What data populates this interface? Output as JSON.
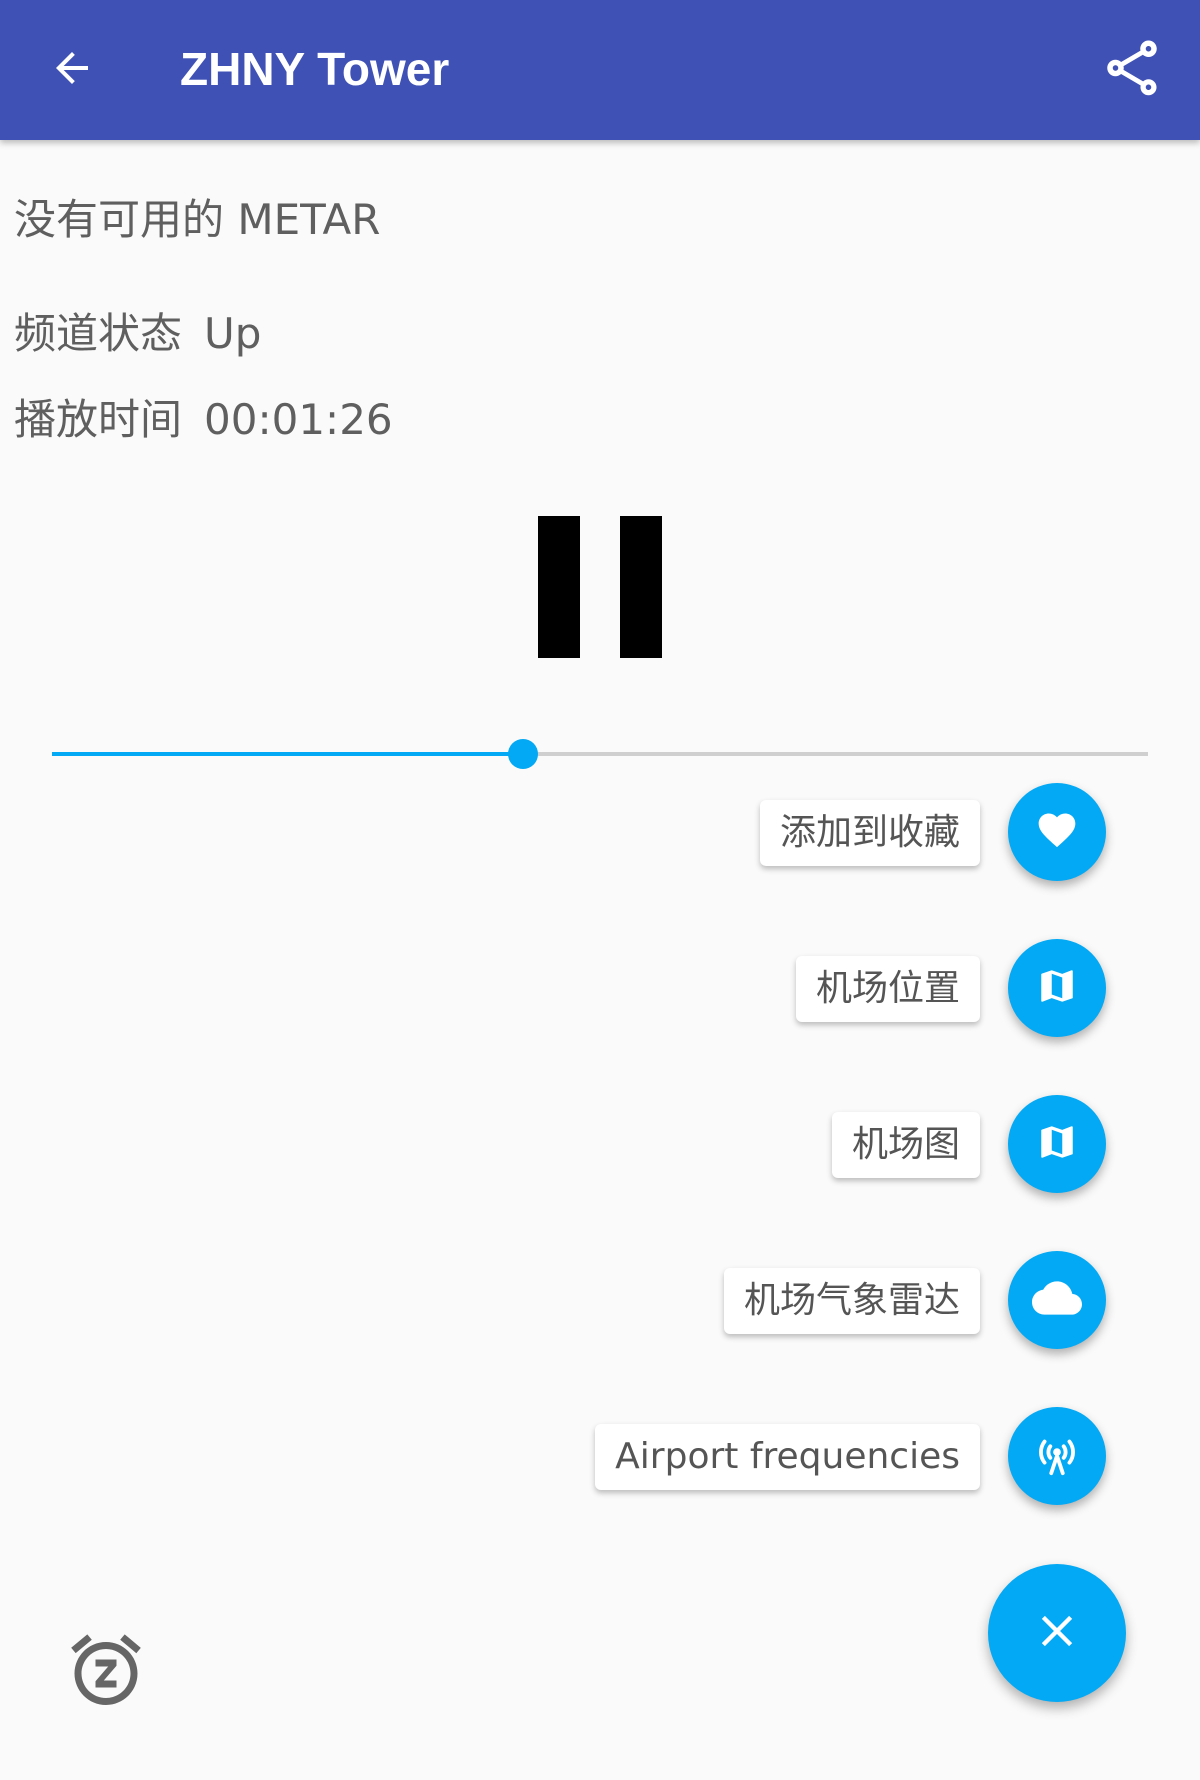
{
  "app_bar": {
    "title": "ZHNY Tower",
    "back_icon": "arrow-back-icon",
    "share_icon": "share-icon",
    "color": "#3f51b5"
  },
  "info": {
    "metar_text": "没有可用的 METAR",
    "channel_status_label": "频道状态",
    "channel_status_value": "Up",
    "play_time_label": "播放时间",
    "play_time_value": "00:01:26"
  },
  "player": {
    "control_icon": "pause-icon",
    "seek_progress": 0.43,
    "accent_color": "#03a9f4"
  },
  "fab_menu": {
    "items": [
      {
        "label": "添加到收藏",
        "icon": "heart-icon"
      },
      {
        "label": "机场位置",
        "icon": "map-icon"
      },
      {
        "label": "机场图",
        "icon": "map-icon"
      },
      {
        "label": "机场气象雷达",
        "icon": "cloud-icon"
      },
      {
        "label": "Airport frequencies",
        "icon": "radio-tower-icon"
      }
    ],
    "close_icon": "close-icon"
  },
  "sleep_timer": {
    "icon": "snooze-alarm-icon"
  }
}
